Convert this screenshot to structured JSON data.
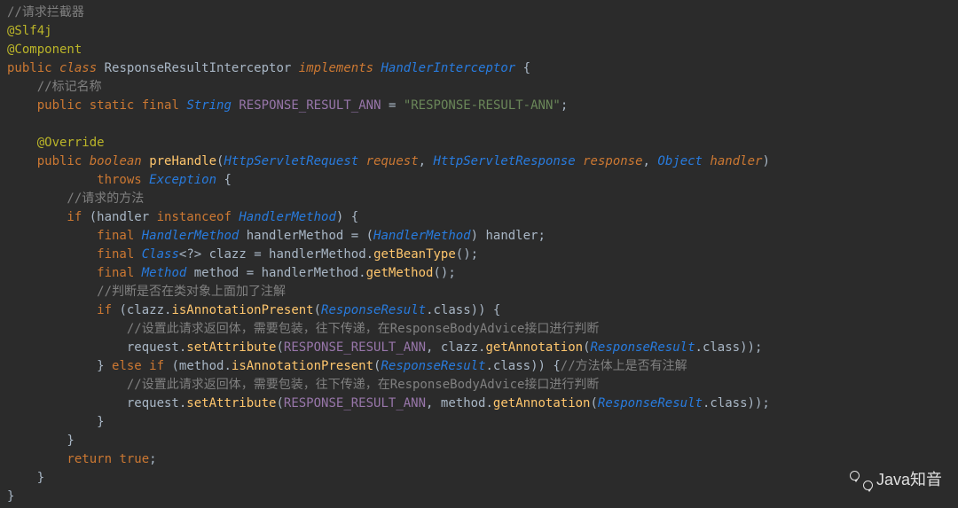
{
  "code": {
    "line1_comment": "//请求拦截器",
    "line2_ann": "@Slf4j",
    "line3_ann": "@Component",
    "line4_public": "public",
    "line4_class": "class",
    "line4_name": "ResponseResultInterceptor",
    "line4_impl": "implements",
    "line4_iface": "HandlerInterceptor",
    "line4_brace": " {",
    "line5_comment": "    //标记名称",
    "line6_public": "    public",
    "line6_static": "static",
    "line6_final": "final",
    "line6_type": "String",
    "line6_name": "RESPONSE_RESULT_ANN",
    "line6_eq": " = ",
    "line6_str": "\"RESPONSE-RESULT-ANN\"",
    "line6_semi": ";",
    "line8_ann": "    @Override",
    "line9_public": "    public",
    "line9_boolean": "boolean",
    "line9_method": "preHandle",
    "line9_p1type": "HttpServletRequest",
    "line9_p1name": "request",
    "line9_p2type": "HttpServletResponse",
    "line9_p2name": "response",
    "line9_p3type": "Object",
    "line9_p3name": "handler",
    "line10_throws": "            throws",
    "line10_exc": "Exception",
    "line10_brace": " {",
    "line11_comment": "        //请求的方法",
    "line12_if": "        if",
    "line12_open": " (handler ",
    "line12_inst": "instanceof",
    "line12_type": "HandlerMethod",
    "line12_close": ") {",
    "line13_final": "            final",
    "line13_type": "HandlerMethod",
    "line13_var": " handlerMethod = (",
    "line13_cast": "HandlerMethod",
    "line13_rest": ") handler;",
    "line14_final": "            final",
    "line14_type": "Class",
    "line14_gen": "<?>",
    "line14_var": " clazz = handlerMethod.",
    "line14_call": "getBeanType",
    "line14_end": "();",
    "line15_final": "            final",
    "line15_type": "Method",
    "line15_var": " method = handlerMethod.",
    "line15_call": "getMethod",
    "line15_end": "();",
    "line16_comment": "            //判断是否在类对象上面加了注解",
    "line17_if": "            if",
    "line17_open": " (clazz.",
    "line17_call": "isAnnotationPresent",
    "line17_arg": "ResponseResult",
    "line17_cls": ".class",
    "line17_close": ")) {",
    "line18_comment": "                //设置此请求返回体，需要包装，往下传递，在ResponseBodyAdvice接口进行判断",
    "line19_pre": "                request.",
    "line19_call": "setAttribute",
    "line19_open": "(",
    "line19_const": "RESPONSE_RESULT_ANN",
    "line19_comma": ", clazz.",
    "line19_call2": "getAnnotation",
    "line19_arg": "ResponseResult",
    "line19_cls": ".class",
    "line19_end": "));",
    "line20_close": "            } ",
    "line20_else": "else if",
    "line20_open": " (method.",
    "line20_call": "isAnnotationPresent",
    "line20_arg": "ResponseResult",
    "line20_cls": ".class",
    "line20_close2": ")) {",
    "line20_comment": "//方法体上是否有注解",
    "line21_comment": "                //设置此请求返回体，需要包装，往下传递，在ResponseBodyAdvice接口进行判断",
    "line22_pre": "                request.",
    "line22_call": "setAttribute",
    "line22_open": "(",
    "line22_const": "RESPONSE_RESULT_ANN",
    "line22_comma": ", method.",
    "line22_call2": "getAnnotation",
    "line22_arg": "ResponseResult",
    "line22_cls": ".class",
    "line22_end": "));",
    "line23_close": "            }",
    "line24_close": "        }",
    "line25_return": "        return",
    "line25_true": "true",
    "line25_semi": ";",
    "line26_close": "    }",
    "line27_close": "}"
  },
  "watermark": "Java知音"
}
